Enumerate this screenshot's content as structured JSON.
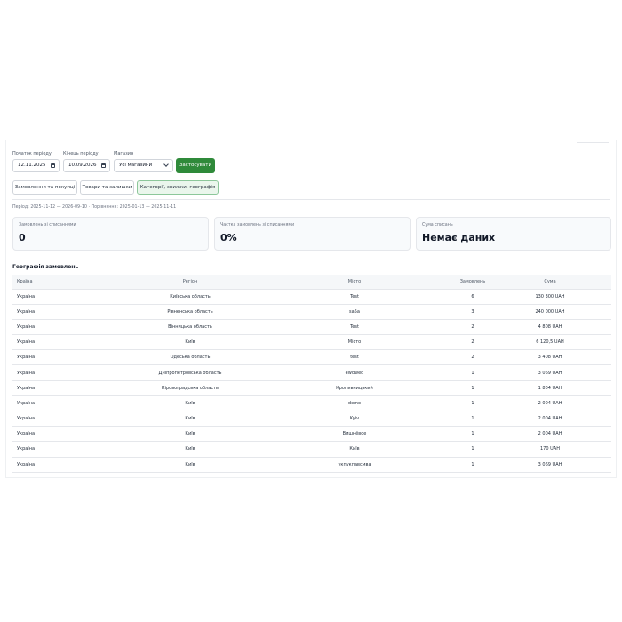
{
  "filters": {
    "start_label": "Початок періоду",
    "start_value": "12.11.2025",
    "end_label": "Кінець періоду",
    "end_value": "10.09.2026",
    "store_label": "Магазин",
    "store_value": "Усі магазини",
    "apply_label": "Застосувати"
  },
  "tabs": [
    {
      "label": "Замовлення та покупці",
      "active": false
    },
    {
      "label": "Товари та залишки",
      "active": false
    },
    {
      "label": "Категорії, знижки, географія",
      "active": true
    }
  ],
  "period_text": "Період: 2025-11-12 — 2026-09-10 · Порівняння: 2025-01-13 — 2025-11-11",
  "cards": [
    {
      "label": "Замовлень зі списаннями",
      "value": "0"
    },
    {
      "label": "Частка замовлень зі списаннями",
      "value": "0%"
    },
    {
      "label": "Сума списань",
      "value": "Немає даних"
    }
  ],
  "geo": {
    "title": "Географія замовлень",
    "columns": [
      "Країна",
      "Регіон",
      "Місто",
      "Замовлень",
      "Сума"
    ],
    "rows": [
      [
        "Україна",
        "Київська область",
        "Test",
        "6",
        "130 300 UAH"
      ],
      [
        "Україна",
        "Рівненська область",
        "sa5a",
        "3",
        "240 000 UAH"
      ],
      [
        "Україна",
        "Вінницька область",
        "Test",
        "2",
        "4 808 UAH"
      ],
      [
        "Україна",
        "Київ",
        "Місто",
        "2",
        "6 120,5 UAH"
      ],
      [
        "Україна",
        "Одеська область",
        "test",
        "2",
        "3 408 UAH"
      ],
      [
        "Україна",
        "Дніпропетровська область",
        "ewdwed",
        "1",
        "3 069 UAH"
      ],
      [
        "Україна",
        "Кіровоградська область",
        "Кропивницький",
        "1",
        "1 804 UAH"
      ],
      [
        "Україна",
        "Київ",
        "demo",
        "1",
        "2 004 UAH"
      ],
      [
        "Україна",
        "Київ",
        "Kyiv",
        "1",
        "2 004 UAH"
      ],
      [
        "Україна",
        "Київ",
        "Вишнёвое",
        "1",
        "2 004 UAH"
      ],
      [
        "Україна",
        "Київ",
        "Київ",
        "1",
        "170 UAH"
      ],
      [
        "Україна",
        "Київ",
        "укпукпавсмва",
        "1",
        "3 069 UAH"
      ]
    ]
  },
  "icons": {
    "date": "calendar-icon",
    "select": "chevron-down-icon"
  },
  "colors": {
    "accent": "#2f8a3a",
    "active_tab_bg": "#eaf6ec"
  }
}
